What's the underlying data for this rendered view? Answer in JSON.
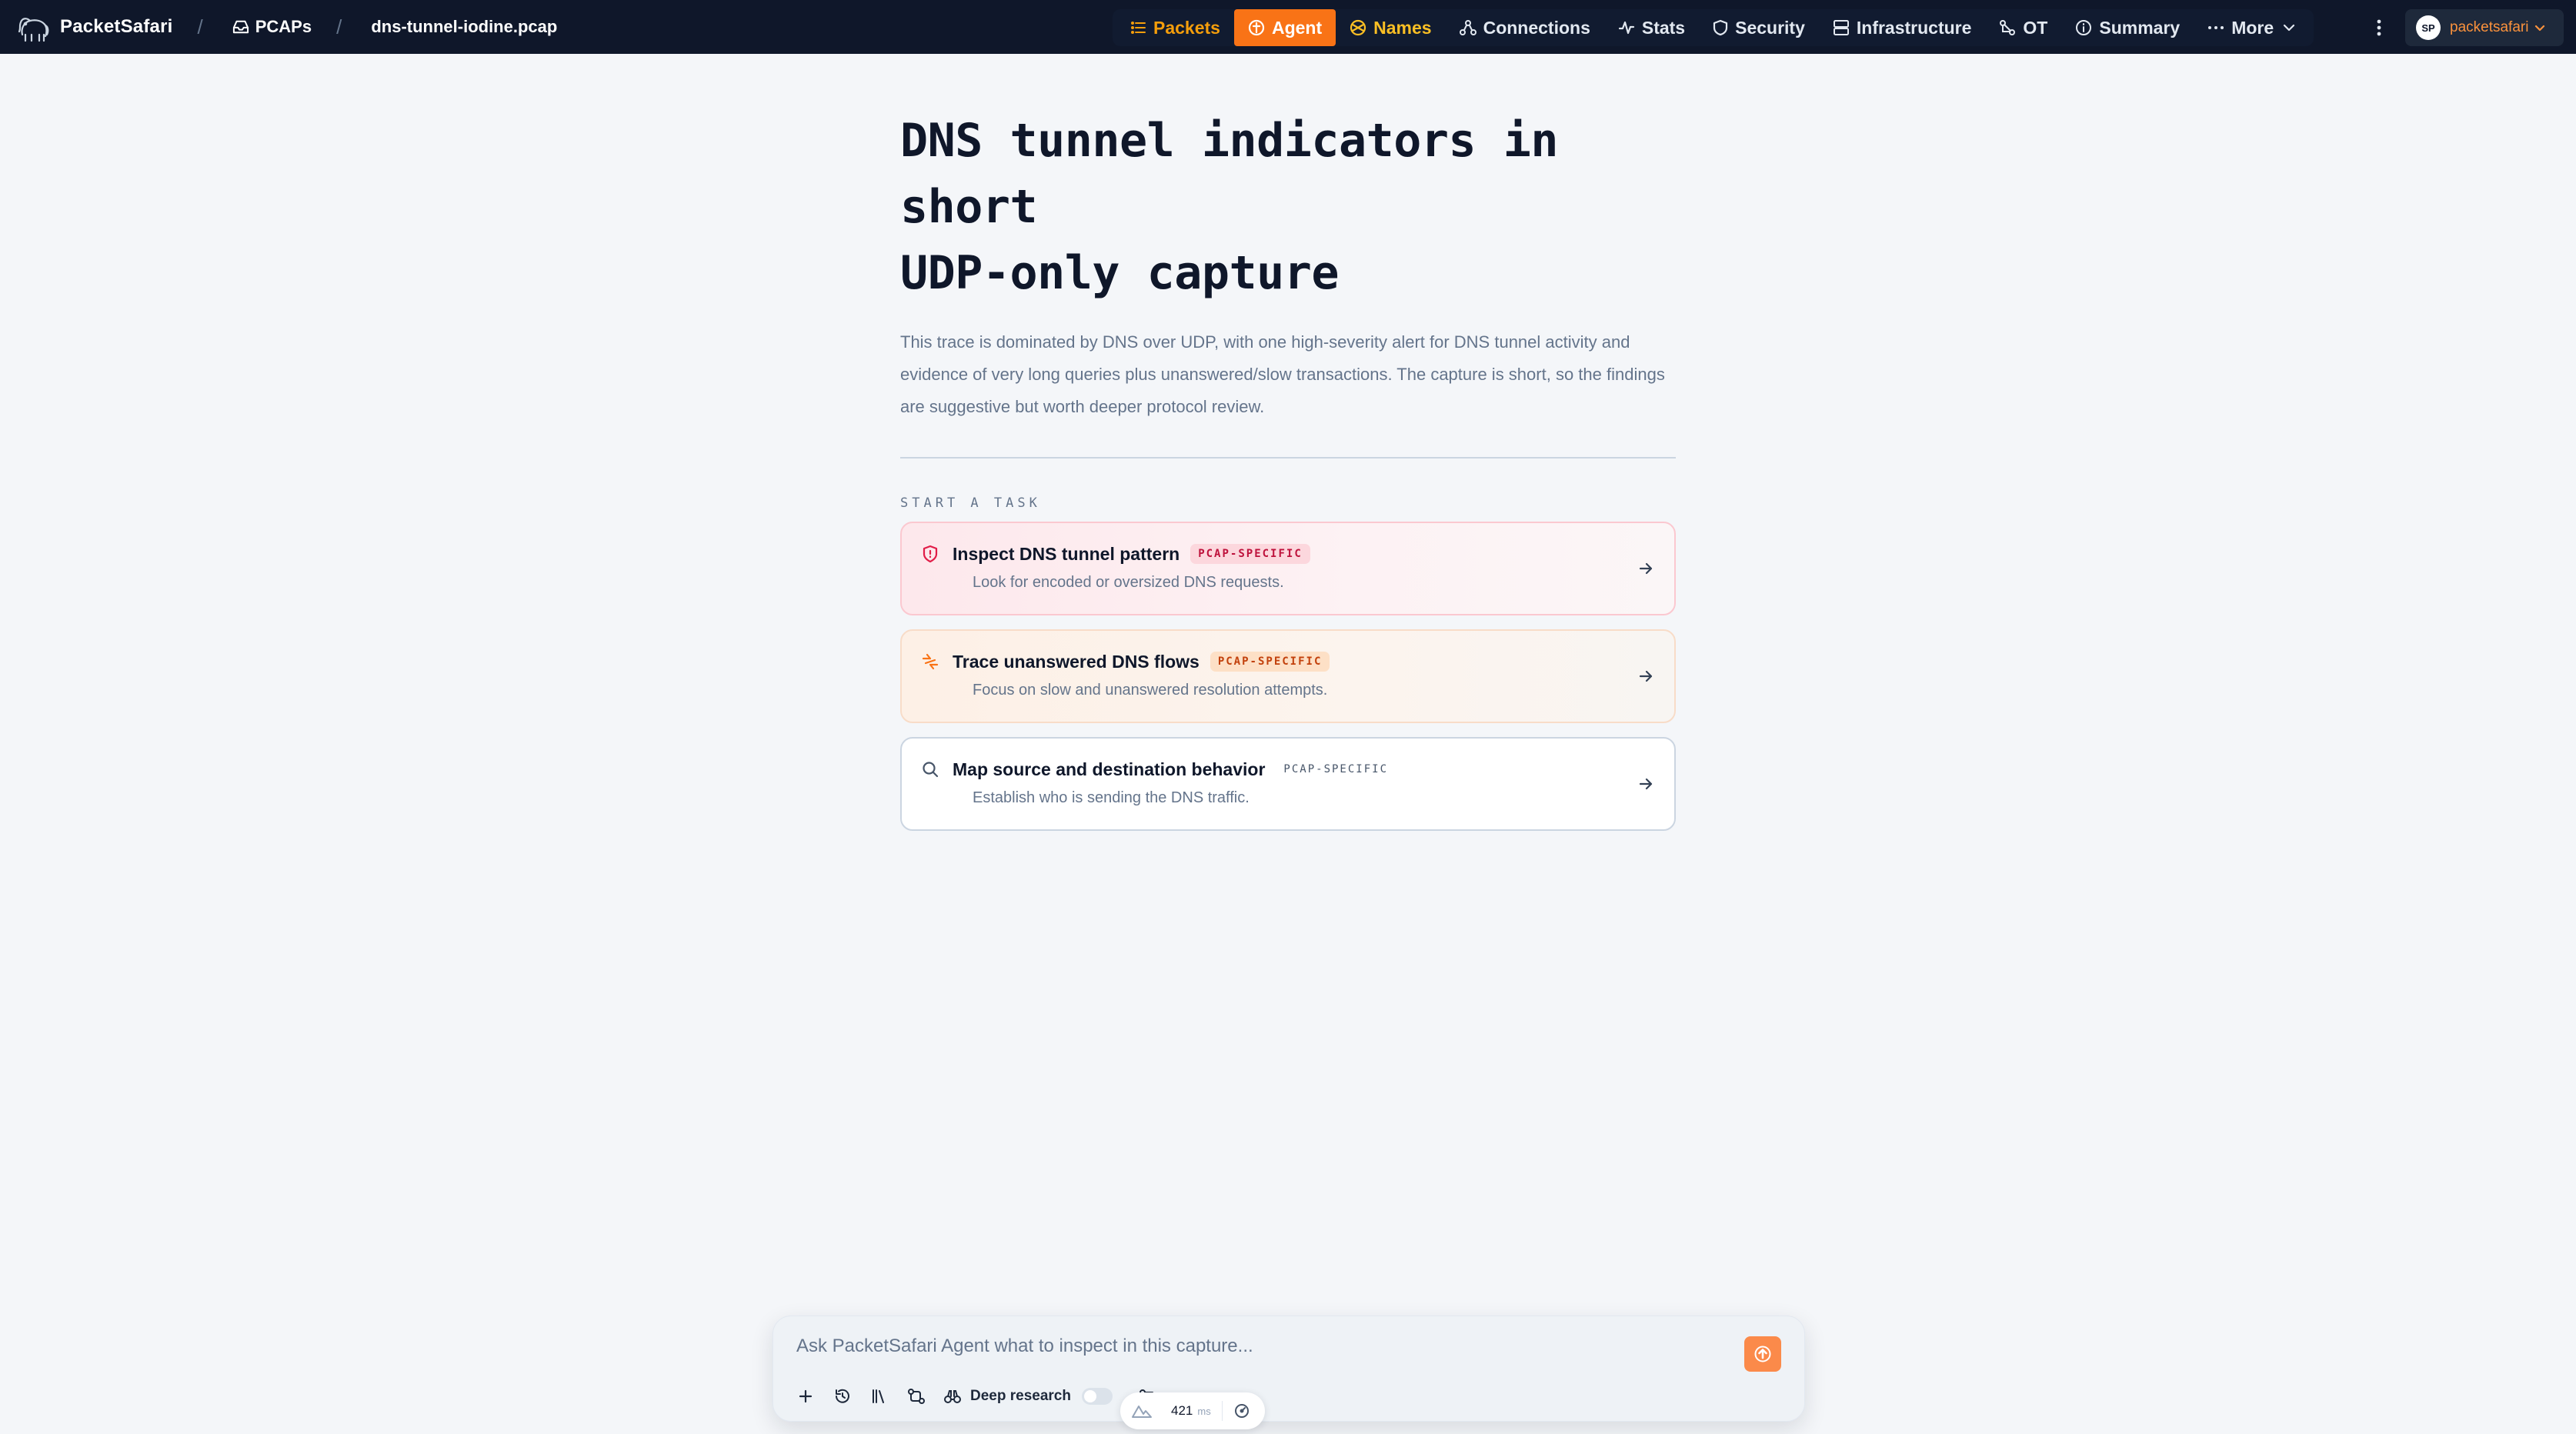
{
  "header": {
    "brand": "PacketSafari",
    "breadcrumbs": [
      "PCAPs",
      "dns-tunnel-iodine.pcap"
    ],
    "nav": [
      {
        "label": "Packets",
        "icon": "list-icon"
      },
      {
        "label": "Agent",
        "icon": "agent-icon"
      },
      {
        "label": "Names",
        "icon": "globe-icon"
      },
      {
        "label": "Connections",
        "icon": "network-icon"
      },
      {
        "label": "Stats",
        "icon": "activity-icon"
      },
      {
        "label": "Security",
        "icon": "shield-icon"
      },
      {
        "label": "Infrastructure",
        "icon": "server-icon"
      },
      {
        "label": "OT",
        "icon": "ot-icon"
      },
      {
        "label": "Summary",
        "icon": "info-icon"
      },
      {
        "label": "More",
        "icon": "ellipsis-icon"
      }
    ],
    "active_tab": "Agent",
    "user": {
      "initials": "SP",
      "name": "packetsafari"
    },
    "colors": {
      "bar": "#0f172a",
      "accent": "#f97316"
    }
  },
  "main": {
    "title_line1": "DNS tunnel indicators in short",
    "title_line2": "UDP-only capture",
    "description": "This trace is dominated by DNS over UDP, with one high-severity alert for DNS tunnel activity and evidence of very long queries plus unanswered/slow transactions. The capture is short, so the findings are suggestive but worth deeper protocol review.",
    "section_label": "START A TASK",
    "tasks": [
      {
        "title": "Inspect DNS tunnel pattern",
        "badge": "PCAP-SPECIFIC",
        "subtitle": "Look for encoded or oversized DNS requests.",
        "icon": "shield-alert-icon"
      },
      {
        "title": "Trace unanswered DNS flows",
        "badge": "PCAP-SPECIFIC",
        "subtitle": "Focus on slow and unanswered resolution attempts.",
        "icon": "zap-icon"
      },
      {
        "title": "Map source and destination behavior",
        "badge": "PCAP-SPECIFIC",
        "subtitle": "Establish who is sending the DNS traffic.",
        "icon": "search-icon"
      }
    ]
  },
  "composer": {
    "placeholder": "Ask PacketSafari Agent what to inspect in this capture...",
    "deep_research_label": "Deep research",
    "deep_research_enabled": false,
    "latency_value": "421",
    "latency_unit": "ms"
  }
}
